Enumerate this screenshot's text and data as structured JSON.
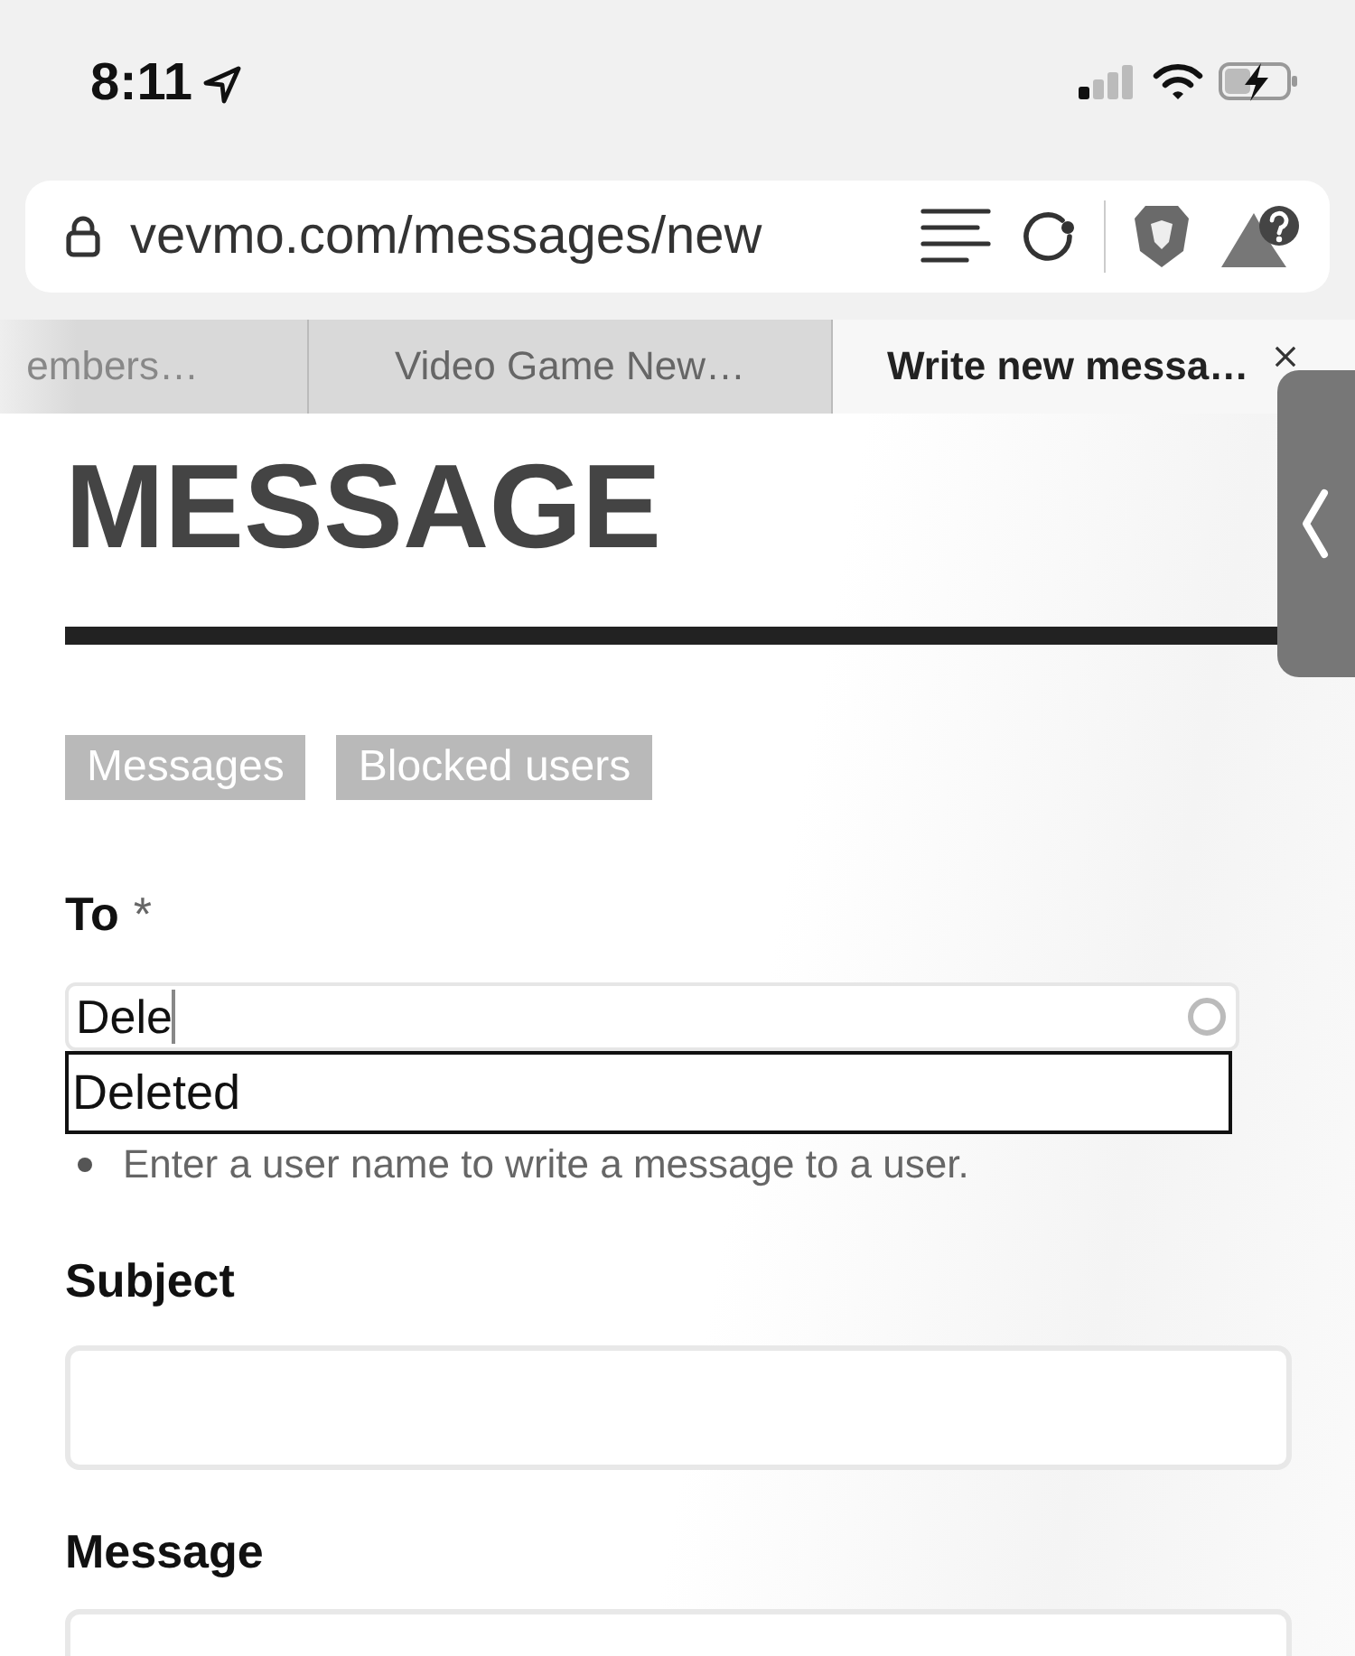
{
  "status_bar": {
    "time": "8:11"
  },
  "address_bar": {
    "url": "vevmo.com/messages/new"
  },
  "tabs": [
    {
      "label": "embers…",
      "selected": false
    },
    {
      "label": "Video Game New…",
      "selected": false
    },
    {
      "label": "Write new messa…",
      "selected": true
    }
  ],
  "page": {
    "title": "MESSAGE",
    "nav": [
      {
        "label": "Messages"
      },
      {
        "label": "Blocked users"
      }
    ],
    "fields": [
      {
        "kind": "autocomplete",
        "label": "To",
        "required_mark": "*",
        "value": "Dele",
        "suggestions": [
          "Deleted"
        ],
        "hint": "Enter a user name to write a message to a user."
      },
      {
        "kind": "text",
        "label": "Subject"
      },
      {
        "kind": "textarea",
        "label": "Message"
      }
    ]
  }
}
